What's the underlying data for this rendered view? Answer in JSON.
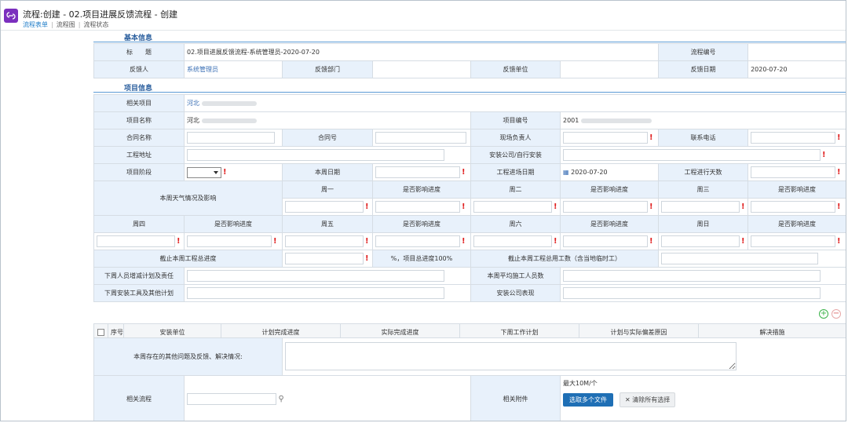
{
  "window": {
    "title": "流程:创建 - 02.项目进展反馈流程 - 创建",
    "subnav": [
      "流程表单",
      "流程图",
      "流程状态"
    ]
  },
  "sections": {
    "basic": "基本信息",
    "project": "项目信息"
  },
  "basic": {
    "title_label": "标　　题",
    "title_value": "02.项目进展反馈流程-系统管理员-2020-07-20",
    "flow_no_label": "流程编号",
    "reporter_label": "反馈人",
    "reporter_value": "系统管理员",
    "dept_label": "反馈部门",
    "unit_label": "反馈单位",
    "date_label": "反馈日期",
    "date_value": "2020-07-20"
  },
  "project": {
    "related_label": "相关项目",
    "related_value": "河北",
    "name_label": "项目名称",
    "name_value": "河北",
    "proj_no_label": "项目编号",
    "proj_no_value": "2001",
    "contract_name_label": "合同名称",
    "contract_no_label": "合同号",
    "site_lead_label": "现场负责人",
    "phone_label": "联系电话",
    "address_label": "工程地址",
    "install_label": "安装公司/自行安装",
    "stage_label": "项目阶段",
    "week_date_label": "本周日期",
    "entry_date_label": "工程进场日期",
    "entry_date_value": "2020-07-20",
    "days_label": "工程进行天数",
    "weather_label": "本周天气情况及影响",
    "mon": "周一",
    "tue": "周二",
    "wed": "周三",
    "thu": "周四",
    "fri": "周五",
    "sat": "周六",
    "sun": "周日",
    "affect": "是否影响进度",
    "progress_label": "截止本周工程总进度",
    "progress_hint": "%，项目总进度100%",
    "labor_label": "截止本周工程总用工数（含当地临时工）",
    "next_plan_label": "下周人员增减计划及责任",
    "avg_workers_label": "本周平均施工人员数",
    "next_tools_label": "下周安装工具及其他计划",
    "install_perf_label": "安装公司表现"
  },
  "detail_table": {
    "columns": [
      "序号",
      "安装单位",
      "计划完成进度",
      "实际完成进度",
      "下周工作计划",
      "计划与实际偏差原因",
      "解决措施"
    ],
    "add_icon": "+",
    "remove_icon": "−"
  },
  "issues": {
    "label": "本周存在的其他问题及反馈、解决情况:"
  },
  "footer": {
    "related_flow_label": "相关流程",
    "attach_label": "相关附件",
    "attach_limit": "最大10M/个",
    "select_files": "选取多个文件",
    "clear_all": "清除所有选择"
  },
  "colors": {
    "accent": "#1f6fb5",
    "label_bg": "#e8f1fb",
    "required": "#e02020",
    "logo": "#7b2fbe"
  }
}
